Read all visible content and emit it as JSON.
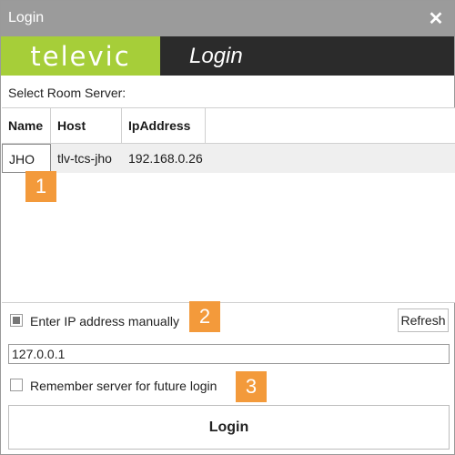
{
  "window": {
    "title": "Login",
    "close_glyph": "✕"
  },
  "banner": {
    "brand": "televic",
    "title": "Login",
    "brand_color": "#a6ce39",
    "dark_color": "#2b2b2b"
  },
  "server_list": {
    "label": "Select Room Server:",
    "columns": [
      "Name",
      "Host",
      "IpAddress"
    ],
    "rows": [
      {
        "name": "JHO",
        "host": "tlv-tcs-jho",
        "ip": "192.168.0.26"
      }
    ]
  },
  "manual_ip": {
    "label": "Enter IP address manually",
    "checked": true,
    "value": "127.0.0.1"
  },
  "refresh_label": "Refresh",
  "remember": {
    "label": "Remember server for future login",
    "checked": false
  },
  "login_label": "Login",
  "callouts": [
    "1",
    "2",
    "3"
  ],
  "callout_color": "#f39a3b",
  "icons": {
    "close": "close-icon"
  }
}
